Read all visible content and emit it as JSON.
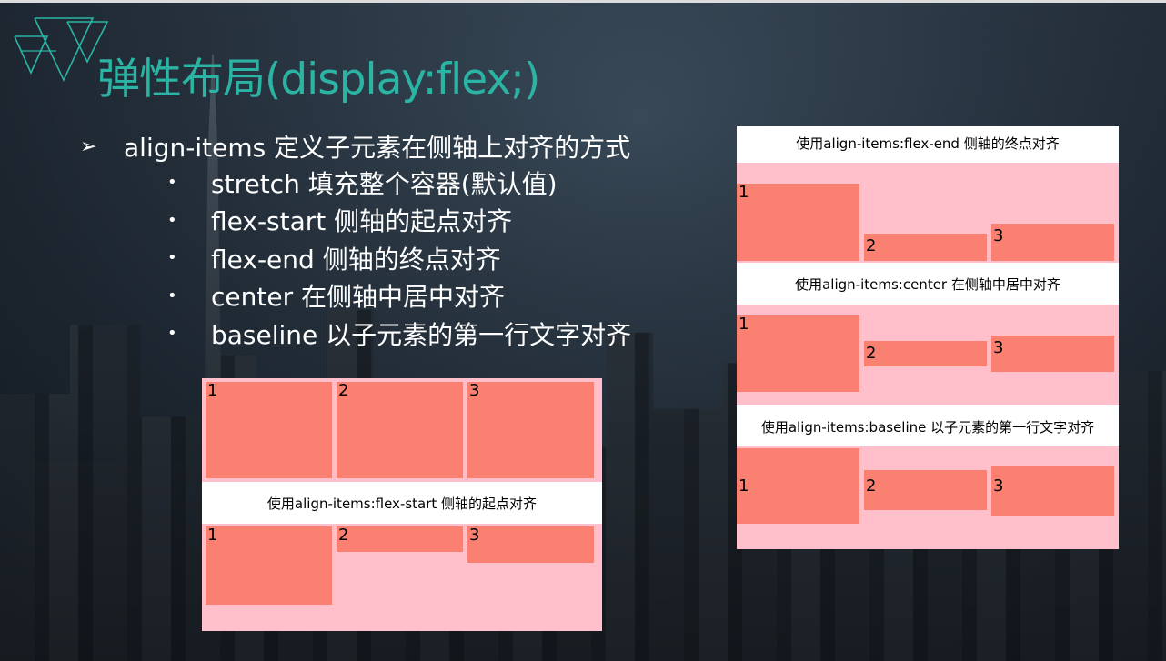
{
  "slide": {
    "title": "弹性布局(display:flex;)",
    "logo_icon": "triangle-logo-icon",
    "accent_color": "#2bb3a3"
  },
  "bullets": {
    "main_icon": "arrow-bullet-icon",
    "main": "align-items 定义子元素在侧轴上对齐的方式",
    "sub_icon": "dot-bullet-icon",
    "items": [
      "stretch 填充整个容器(默认值)",
      "flex-start 侧轴的起点对齐",
      "flex-end 侧轴的终点对齐",
      "center 在侧轴中居中对齐",
      "baseline 以子元素的第一行文字对齐"
    ]
  },
  "demo": {
    "container_color": "#ffc0cb",
    "item_color": "#fa8072",
    "left_panel": {
      "stretch_items": [
        "1",
        "2",
        "3"
      ],
      "flex_start_label": "使用align-items:flex-start 侧轴的起点对齐",
      "flex_start_items": [
        "1",
        "2",
        "3"
      ]
    },
    "right_panel": {
      "flex_end_label": "使用align-items:flex-end 侧轴的终点对齐",
      "flex_end_items": [
        "1",
        "2",
        "3"
      ],
      "center_label": "使用align-items:center 在侧轴中居中对齐",
      "center_items": [
        "1",
        "2",
        "3"
      ],
      "baseline_label": "使用align-items:baseline 以子元素的第一行文字对齐",
      "baseline_items": [
        "1",
        "2",
        "3"
      ]
    }
  }
}
